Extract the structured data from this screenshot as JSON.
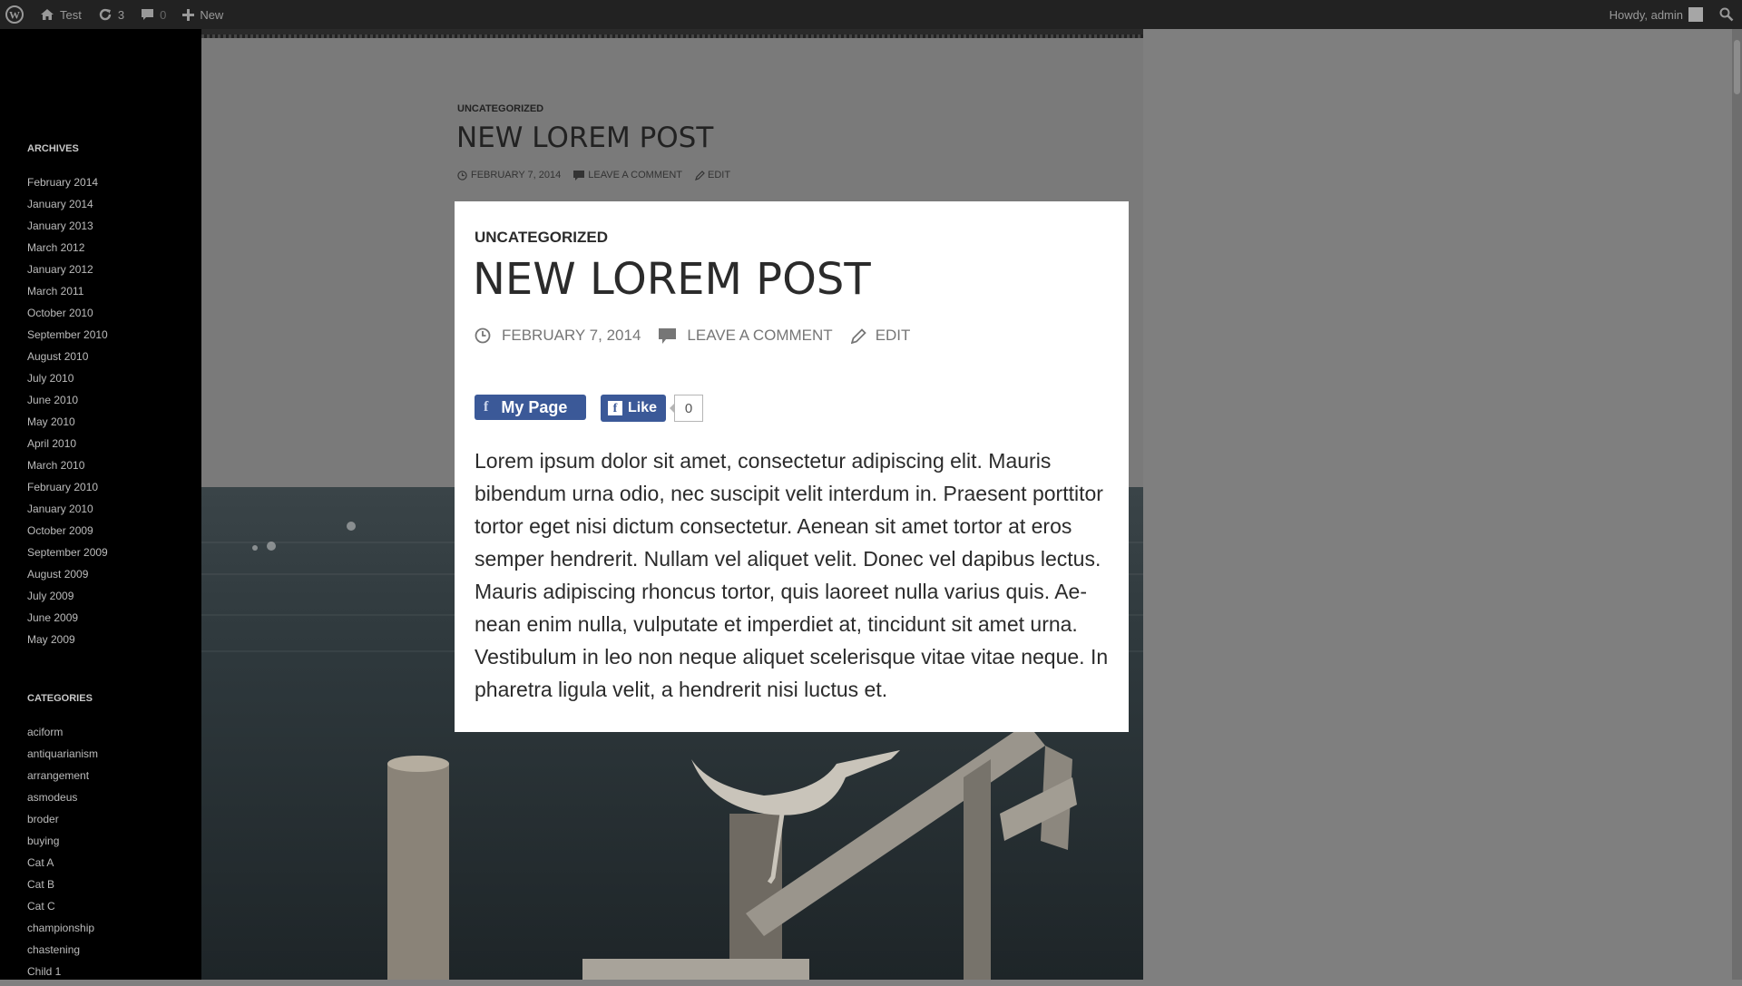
{
  "adminbar": {
    "site_name": "Test",
    "updates_count": "3",
    "comments_count": "0",
    "new_label": "New",
    "howdy": "Howdy, admin"
  },
  "sidebar": {
    "archives_title": "ARCHIVES",
    "archives": [
      "February 2014",
      "January 2014",
      "January 2013",
      "March 2012",
      "January 2012",
      "March 2011",
      "October 2010",
      "September 2010",
      "August 2010",
      "July 2010",
      "June 2010",
      "May 2010",
      "April 2010",
      "March 2010",
      "February 2010",
      "January 2010",
      "October 2009",
      "September 2009",
      "August 2009",
      "July 2009",
      "June 2009",
      "May 2009"
    ],
    "categories_title": "CATEGORIES",
    "categories": [
      "aciform",
      "antiquarianism",
      "arrangement",
      "asmodeus",
      "broder",
      "buying",
      "Cat A",
      "Cat B",
      "Cat C",
      "championship",
      "chastening",
      "Child 1"
    ]
  },
  "background_post": {
    "category": "UNCATEGORIZED",
    "title": "NEW LOREM POST",
    "date": "FEBRUARY 7, 2014",
    "comment": "LEAVE A COMMENT",
    "edit": "EDIT"
  },
  "card": {
    "category": "UNCATEGORIZED",
    "title": "NEW LOREM POST",
    "date": "FEBRUARY 7, 2014",
    "comment": "LEAVE A COMMENT",
    "edit": "EDIT",
    "fb_page_label": "My Page",
    "fb_like_label": "Like",
    "fb_like_count": "0",
    "body": "Lorem ipsum dolor sit amet, consectetur adipiscing elit. Mauris bibendum urna odio, nec suscipit velit interdum in. Praesent porttitor tortor eget nisi dictum consectetur. Aenean sit amet tortor at eros semper hendrerit. Nullam vel aliquet velit. Donec vel dapibus lectus. Mauris adipiscing rhoncus tortor, quis laoreet nulla varius quis. Ae-nean enim nulla, vulputate et imperdiet at, tincidunt sit amet urna. Vestibulum in leo non neque aliquet scelerisque vitae vitae neque. In pharetra ligula velit, a hendrerit nisi luctus et."
  },
  "colors": {
    "facebook_blue": "#3b5998",
    "admin_bar": "#222222",
    "overlay_gray": "#808080"
  }
}
